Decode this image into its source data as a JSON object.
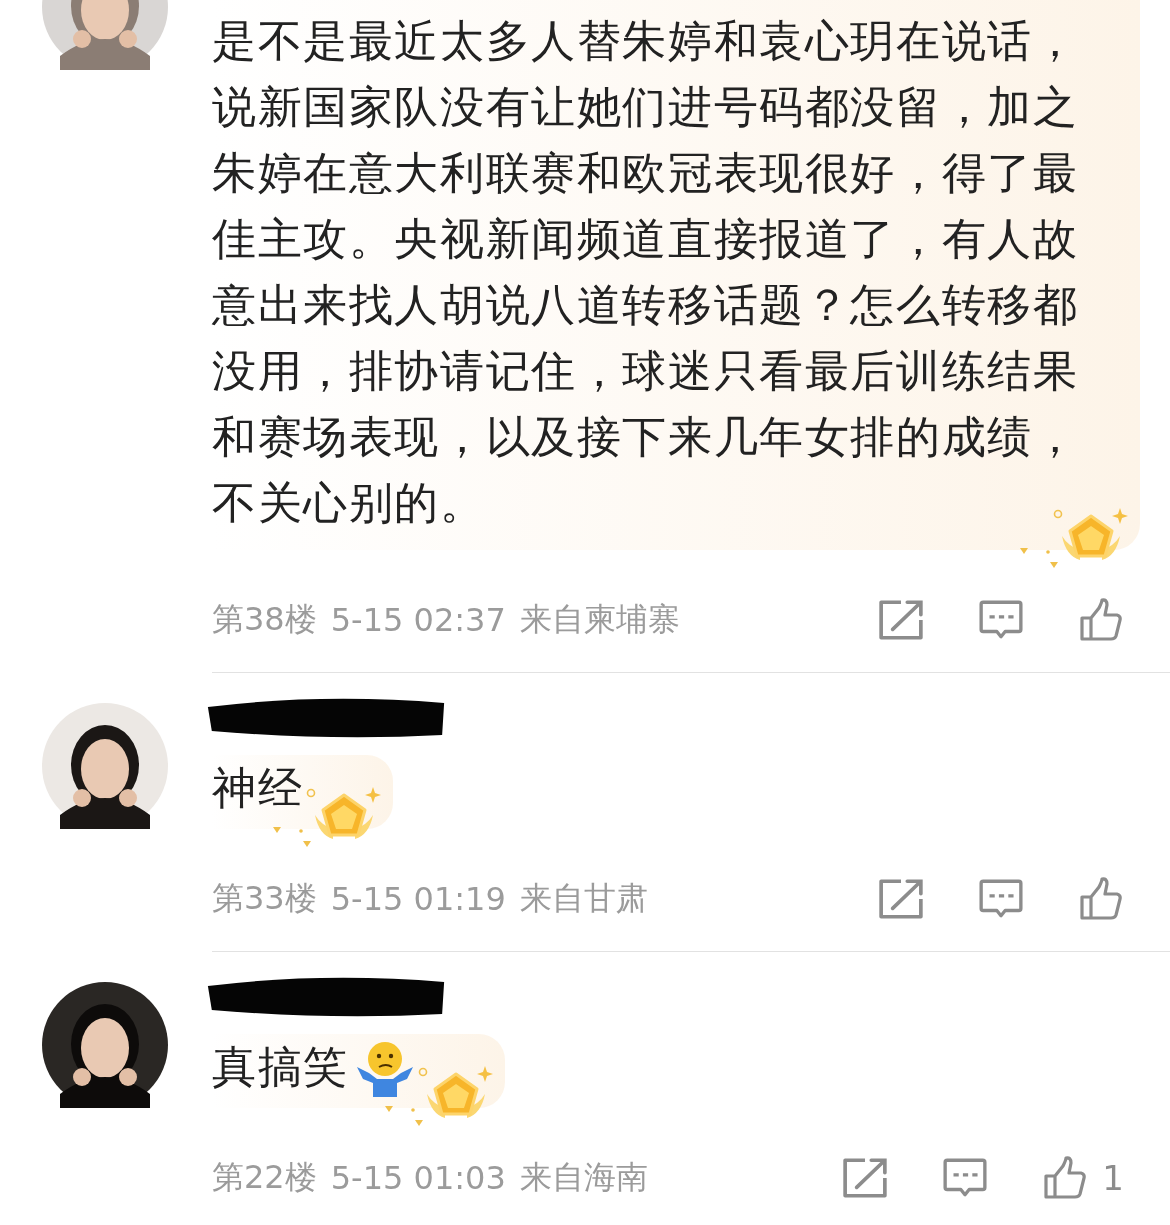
{
  "comments": [
    {
      "redacted_name": false,
      "body": "是不是最近太多人替朱婷和袁心玥在说话，说新国家队没有让她们进号码都没留，加之朱婷在意大利联赛和欧冠表现很好，得了最佳主攻。央视新闻频道直接报道了，有人故意出来找人胡说八道转移话题？怎么转移都没用，排协请记住，球迷只看最后训练结果和赛场表现，以及接下来几年女排的成绩，不关心别的。",
      "emoji": false,
      "floor": "第38楼",
      "date": "5-15 02:37",
      "location": "来自柬埔寨"
    },
    {
      "redacted_name": true,
      "body": "神经",
      "emoji": false,
      "floor": "第33楼",
      "date": "5-15 01:19",
      "location": "来自甘肃"
    },
    {
      "redacted_name": true,
      "body": "真搞笑",
      "emoji": true,
      "floor": "第22楼",
      "date": "5-15 01:03",
      "location": "来自海南",
      "likes": "1"
    }
  ]
}
